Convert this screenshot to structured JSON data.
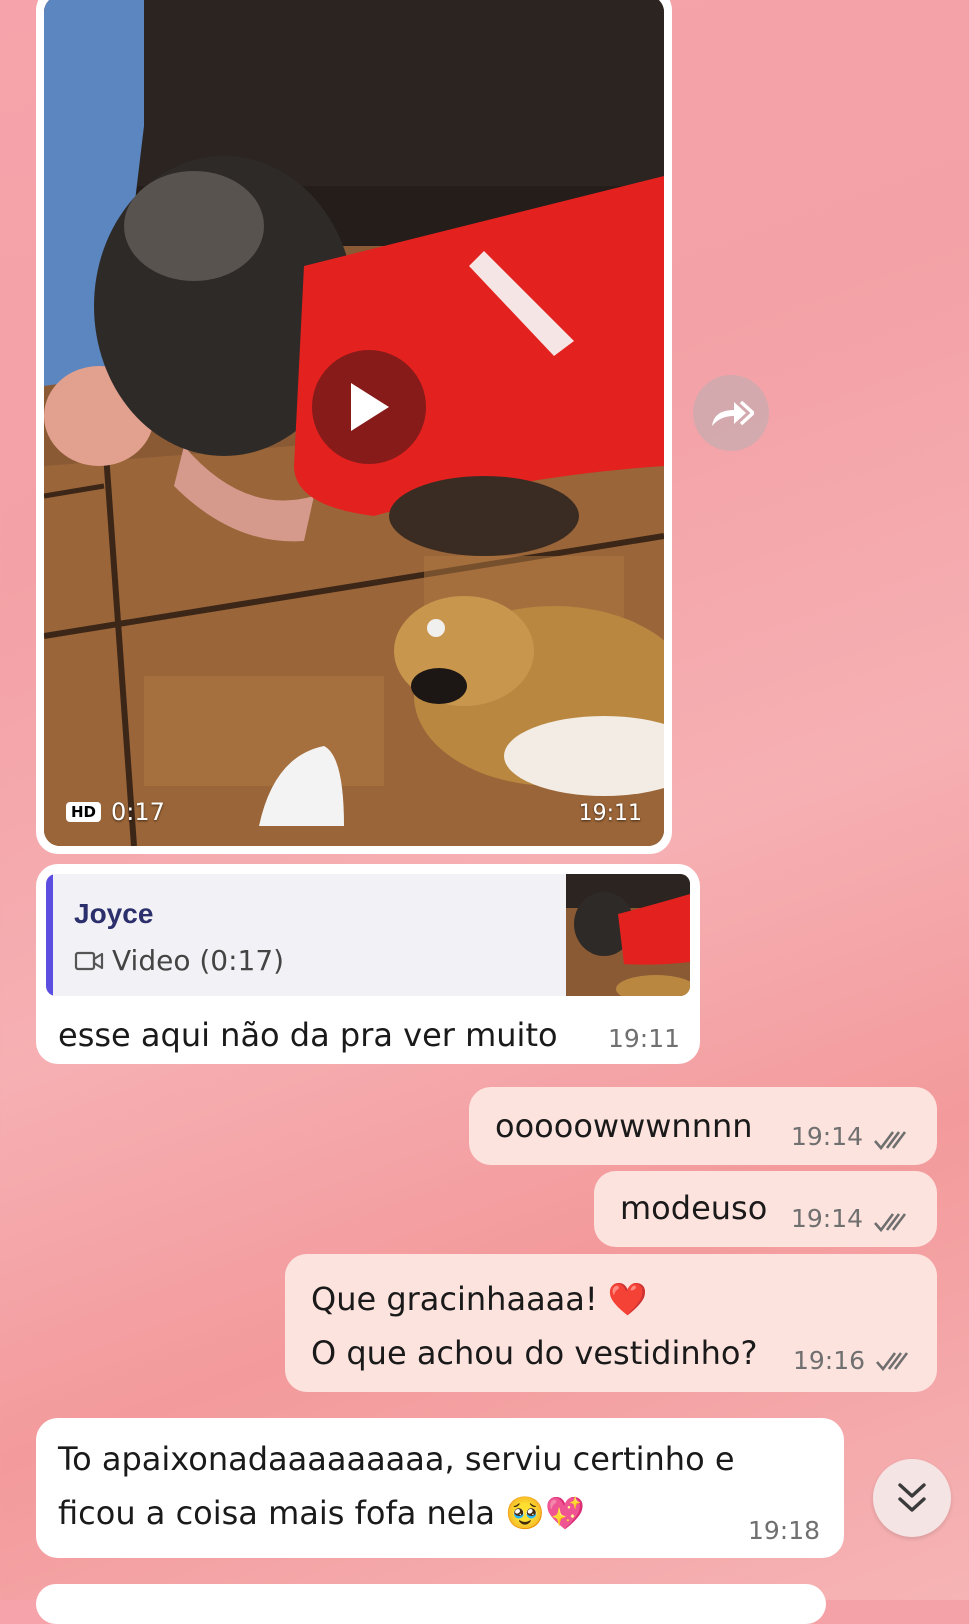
{
  "video_message": {
    "badge": "HD",
    "duration": "0:17",
    "time": "19:11"
  },
  "reply_message": {
    "quote_author": "Joyce",
    "quote_media": "Video (0:17)",
    "text": "esse aqui não da pra ver muito",
    "time": "19:11"
  },
  "outgoing": [
    {
      "text": "ooooowwwnnnn",
      "time": "19:14"
    },
    {
      "text": "modeuso",
      "time": "19:14"
    },
    {
      "line1": "Que gracinhaaaa! ❤️",
      "line2": "O que achou do vestidinho?",
      "time": "19:16"
    }
  ],
  "incoming_last": {
    "line1": "To apaixonadaaaaaaaaa, serviu certinho e",
    "line2": "ficou a coisa mais fofa nela 🥹💖",
    "time": "19:18"
  },
  "icons": {
    "forward": "forward-icon",
    "scroll": "scroll-down-icon",
    "read": "double-check-icon",
    "video": "video-camera-icon",
    "play": "play-icon"
  }
}
